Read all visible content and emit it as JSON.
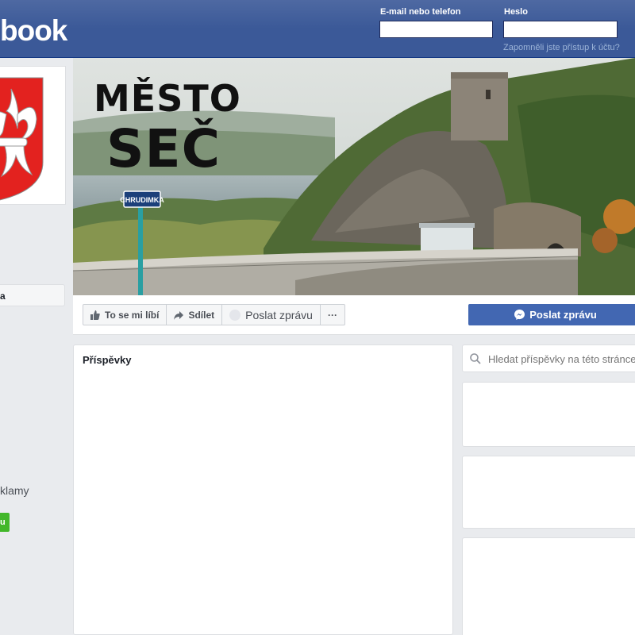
{
  "header": {
    "logo_text": "book",
    "email_label": "E-mail nebo telefon",
    "email_value": "",
    "password_label": "Heslo",
    "password_value": "",
    "forgot_link": "Zapomněli jste přístup k účtu?"
  },
  "left": {
    "nav_item_label": "a",
    "ads_text": "klamy",
    "green_button_label": "u"
  },
  "cover": {
    "title_line1": "MĚSTO",
    "title_line2": "SEČ",
    "sign_text": "CHRUDIMKA"
  },
  "actions": {
    "like_label": "To se mi líbí",
    "share_label": "Sdílet",
    "message_label": "Poslat zprávu",
    "more_label": "···",
    "messenger_label": "Poslat zprávu"
  },
  "posts": {
    "title": "Příspěvky"
  },
  "search": {
    "placeholder": "Hledat příspěvky na této stránce"
  },
  "colors": {
    "brand_blue": "#3b5998",
    "messenger_blue": "#4267b2",
    "green": "#42b72a",
    "page_bg": "#e9ebee"
  }
}
